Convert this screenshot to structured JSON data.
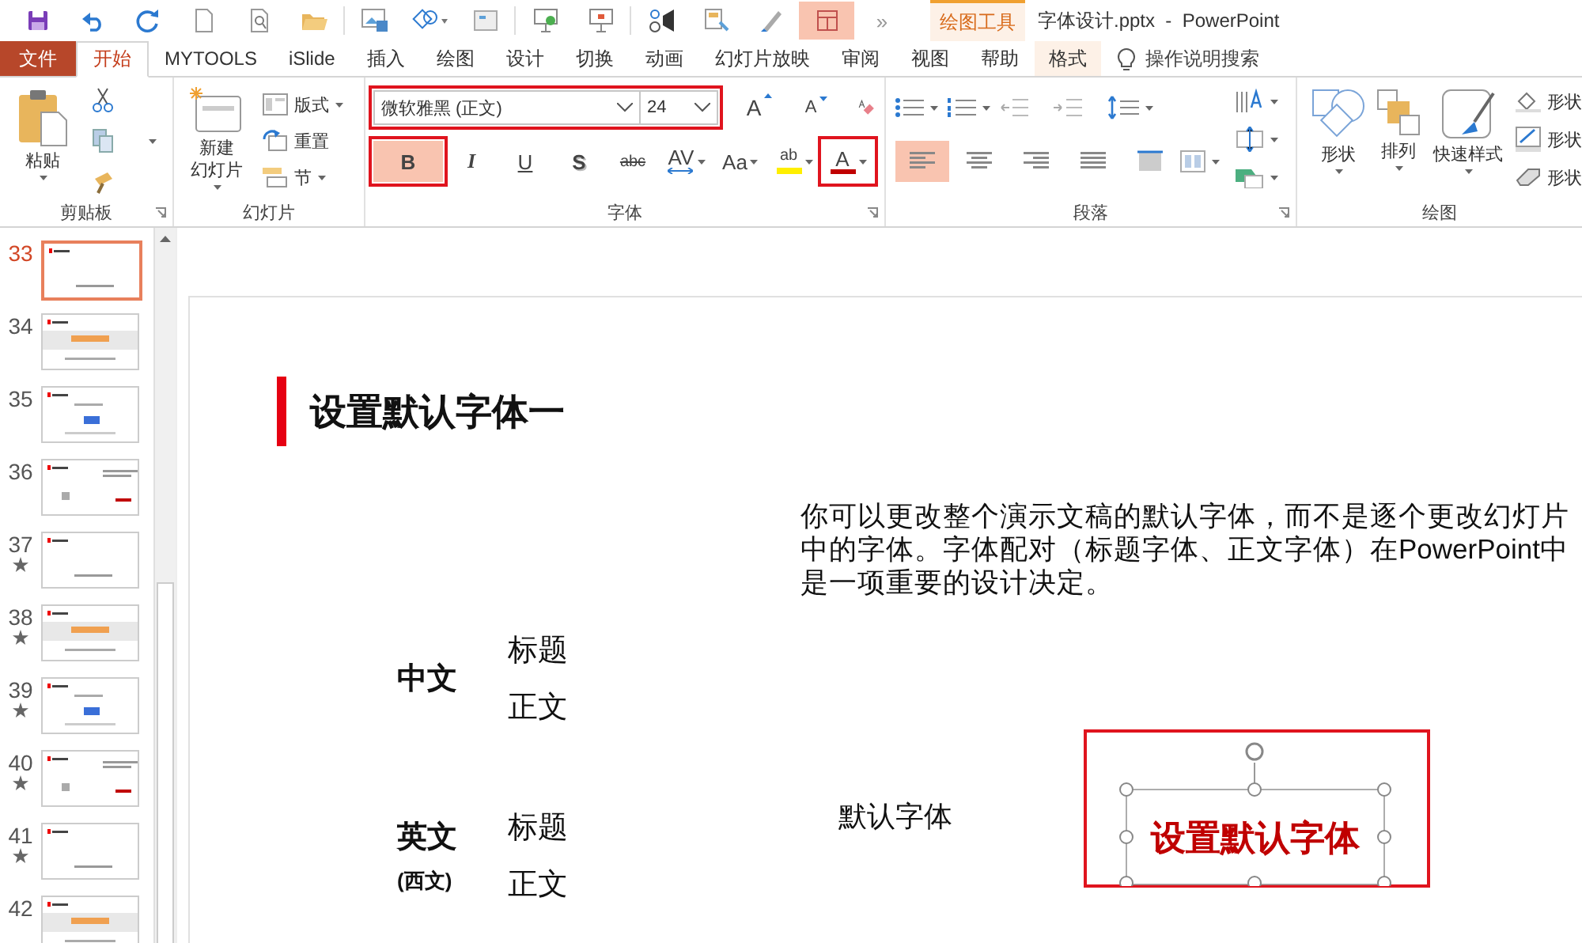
{
  "quick_access": [
    {
      "kind": "save",
      "selected": false
    },
    {
      "kind": "undo",
      "selected": false
    },
    {
      "kind": "redo",
      "selected": false
    },
    {
      "kind": "new",
      "selected": false
    },
    {
      "kind": "preview",
      "selected": false
    },
    {
      "kind": "open",
      "selected": false
    },
    {
      "kind": "sep"
    },
    {
      "kind": "picture",
      "selected": false
    },
    {
      "kind": "shapes",
      "selected": false
    },
    {
      "kind": "textbox",
      "selected": false
    },
    {
      "kind": "sep"
    },
    {
      "kind": "present",
      "selected": false
    },
    {
      "kind": "presenter",
      "selected": false
    },
    {
      "kind": "sep"
    },
    {
      "kind": "record",
      "selected": false
    },
    {
      "kind": "format",
      "selected": false
    },
    {
      "kind": "pen",
      "selected": false
    },
    {
      "kind": "layout",
      "selected": true
    }
  ],
  "overflow": "»",
  "context_header": "绘图工具",
  "title": "字体设计.pptx  -  PowerPoint",
  "tabs": [
    {
      "label": "文件",
      "kind": "file",
      "selected": false
    },
    {
      "label": "开始",
      "kind": "tab",
      "selected": true
    },
    {
      "label": "MYTOOLS",
      "kind": "tab",
      "selected": false
    },
    {
      "label": "iSlide",
      "kind": "tab",
      "selected": false
    },
    {
      "label": "插入",
      "kind": "tab",
      "selected": false
    },
    {
      "label": "绘图",
      "kind": "tab",
      "selected": false
    },
    {
      "label": "设计",
      "kind": "tab",
      "selected": false
    },
    {
      "label": "切换",
      "kind": "tab",
      "selected": false
    },
    {
      "label": "动画",
      "kind": "tab",
      "selected": false
    },
    {
      "label": "幻灯片放映",
      "kind": "tab",
      "selected": false
    },
    {
      "label": "审阅",
      "kind": "tab",
      "selected": false
    },
    {
      "label": "视图",
      "kind": "tab",
      "selected": false
    },
    {
      "label": "帮助",
      "kind": "tab",
      "selected": false
    },
    {
      "label": "格式",
      "kind": "context",
      "selected": false
    }
  ],
  "search": {
    "placeholder": "操作说明搜索"
  },
  "ribbon": {
    "clipboard": {
      "label": "剪贴板",
      "paste": "粘贴"
    },
    "slides": {
      "label": "幻灯片",
      "new_slide": [
        "新建",
        "幻灯片"
      ],
      "items": [
        {
          "kind": "layout",
          "label": "版式",
          "dropdown": true
        },
        {
          "kind": "reset",
          "label": "重置",
          "dropdown": false
        },
        {
          "kind": "section",
          "label": "节",
          "dropdown": true
        }
      ]
    },
    "font": {
      "label": "字体",
      "font_name": "微软雅黑 (正文)",
      "font_size": "24",
      "highlighted": true,
      "size_buttons": [
        "A",
        "A"
      ],
      "formats": [
        {
          "kind": "bold",
          "text": "B",
          "selected": true,
          "highlighted": true
        },
        {
          "kind": "italic",
          "text": "I",
          "selected": false,
          "highlighted": false
        },
        {
          "kind": "underline",
          "text": "U",
          "selected": false,
          "highlighted": false
        },
        {
          "kind": "shadow",
          "text": "S",
          "selected": false,
          "highlighted": false
        },
        {
          "kind": "strike",
          "text": "abc",
          "selected": false,
          "highlighted": false
        },
        {
          "kind": "spacing",
          "text": "AV",
          "selected": false,
          "highlighted": false
        },
        {
          "kind": "case",
          "text": "Aa",
          "selected": false,
          "highlighted": false
        },
        {
          "kind": "highlight",
          "text": "ab",
          "selected": false,
          "highlighted": false
        },
        {
          "kind": "color",
          "text": "A",
          "selected": false,
          "highlighted": true
        }
      ]
    },
    "paragraph": {
      "label": "段落",
      "align": [
        {
          "kind": "left",
          "selected": true
        },
        {
          "kind": "center",
          "selected": false
        },
        {
          "kind": "right",
          "selected": false
        },
        {
          "kind": "justify",
          "selected": false
        },
        {
          "kind": "distributed",
          "selected": false
        }
      ]
    },
    "drawing": {
      "label": "绘图",
      "buttons": [
        "形状",
        "排列",
        "快速样式"
      ],
      "side": [
        "形状",
        "形状",
        "形状"
      ]
    }
  },
  "thumbnails": [
    {
      "number": "33",
      "starred": false,
      "selected": true
    },
    {
      "number": "34",
      "starred": false,
      "selected": false
    },
    {
      "number": "35",
      "starred": false,
      "selected": false
    },
    {
      "number": "36",
      "starred": false,
      "selected": false
    },
    {
      "number": "37",
      "starred": true,
      "selected": false
    },
    {
      "number": "38",
      "starred": true,
      "selected": false
    },
    {
      "number": "39",
      "starred": true,
      "selected": false
    },
    {
      "number": "40",
      "starred": true,
      "selected": false
    },
    {
      "number": "41",
      "starred": true,
      "selected": false
    },
    {
      "number": "42",
      "starred": false,
      "selected": false
    }
  ],
  "slide": {
    "title": "设置默认字体一",
    "paragraph": "你可以更改整个演示文稿的默认字体，而不是逐个更改幻灯片中的字体。字体配对（标题字体、正文字体）在PowerPoint中是一项重要的设计决定。",
    "groups": [
      {
        "label": "中文",
        "items": [
          "标题",
          "正文"
        ]
      },
      {
        "label": "英文",
        "note": "(西文)",
        "items": [
          "标题",
          "正文"
        ]
      }
    ],
    "default_label": "默认字体",
    "sample": {
      "text": "设置默认字体",
      "selected": true,
      "highlighted": true
    }
  }
}
